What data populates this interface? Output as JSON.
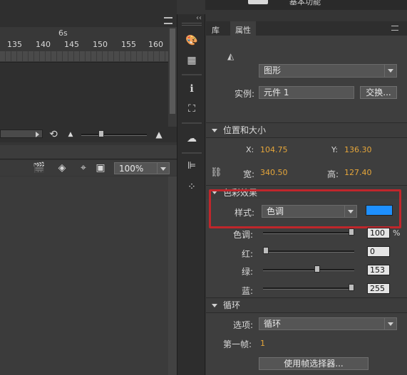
{
  "top": {
    "workspace_label": "基本功能"
  },
  "timeline": {
    "time_marker": "6s",
    "frame_ticks": [
      "135",
      "140",
      "145",
      "150",
      "155",
      "160"
    ],
    "zoom_value": "100%"
  },
  "tabs": {
    "library": "库",
    "properties": "属性"
  },
  "properties": {
    "type_dropdown": "图形",
    "instance_label": "实例:",
    "instance_name": "元件 1",
    "swap_button": "交换..."
  },
  "position_size": {
    "header": "位置和大小",
    "x_label": "X:",
    "x_value": "104.75",
    "y_label": "Y:",
    "y_value": "136.30",
    "w_label": "宽:",
    "w_value": "340.50",
    "h_label": "高:",
    "h_value": "127.40"
  },
  "color_effect": {
    "header": "色彩效果",
    "style_label": "样式:",
    "style_value": "色调",
    "swatch_color": "#1e90ff",
    "tint_label": "色调:",
    "tint_value": "100",
    "tint_unit": "%",
    "tint_level": 1.0,
    "red_label": "红:",
    "red_value": "0",
    "red_level": 0.0,
    "green_label": "绿:",
    "green_value": "153",
    "green_level": 0.6,
    "blue_label": "蓝:",
    "blue_value": "255",
    "blue_level": 1.0
  },
  "loop": {
    "header": "循环",
    "options_label": "选项:",
    "options_value": "循环",
    "first_frame_label": "第一帧:",
    "first_frame_value": "1",
    "frame_picker_button": "使用帧选择器..."
  },
  "colors": {
    "highlight": "#c0262b",
    "accent_orange": "#e6a63a"
  }
}
